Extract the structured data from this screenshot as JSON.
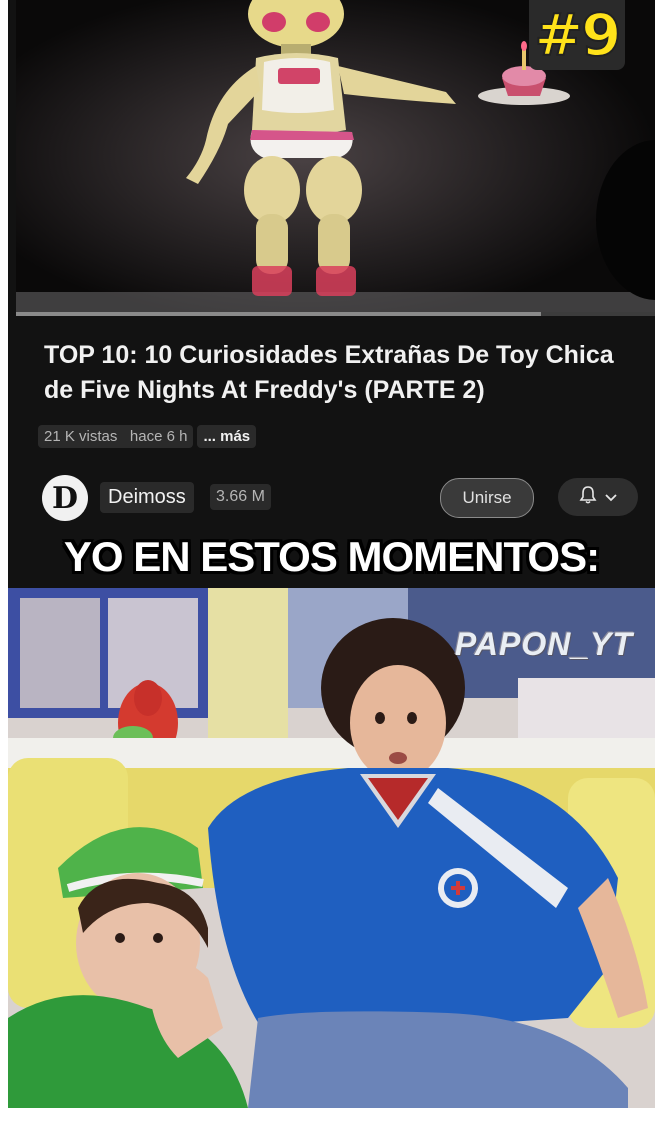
{
  "thumbnail": {
    "episode_badge": "#9",
    "progress_fraction": 0.82
  },
  "video": {
    "title": "TOP 10: 10 Curiosidades Extrañas De Toy Chica de Five Nights At Freddy's (PARTE 2)",
    "views": "21 K vistas",
    "age": "hace 6 h",
    "more_label": "... más"
  },
  "channel": {
    "avatar_letter": "D",
    "name": "Deimoss",
    "subscribers": "3.66 M",
    "join_label": "Unirse",
    "bell_icon": "bell-icon",
    "chevron_icon": "chevron-down-icon"
  },
  "meme": {
    "caption": "YO EN ESTOS MOMENTOS:",
    "watermark": "PAPON_YT"
  },
  "colors": {
    "page_background": "#121212",
    "text_primary": "#f1f1f1",
    "text_secondary": "#b5b5b5",
    "badge_yellow": "#ffe21a",
    "shirt_blue": "#1f5fc0",
    "hat_green": "#4fb34a"
  }
}
